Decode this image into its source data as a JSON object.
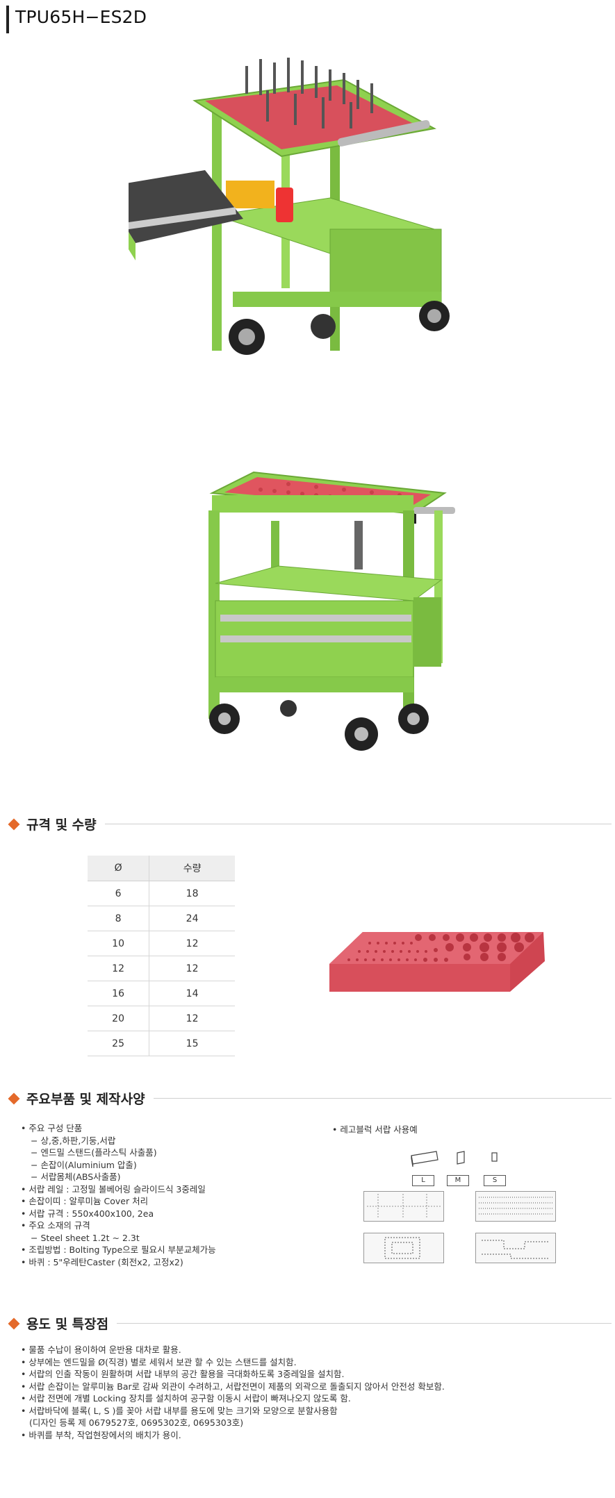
{
  "title": "TPU65H−ES2D",
  "sections": {
    "spec": "규격 및 수량",
    "parts": "주요부품 및 제작사양",
    "uses": "용도 및 특장점"
  },
  "spec_table": {
    "headers": [
      "Ø",
      "수량"
    ],
    "rows": [
      [
        "6",
        "18"
      ],
      [
        "8",
        "24"
      ],
      [
        "10",
        "12"
      ],
      [
        "12",
        "12"
      ],
      [
        "16",
        "14"
      ],
      [
        "20",
        "12"
      ],
      [
        "25",
        "15"
      ]
    ]
  },
  "parts_list": [
    {
      "t": "주요 구성 단품",
      "sub": [
        "− 상,중,하판,기둥,서랍",
        "− 엔드밀 스탠드(플라스틱 사출품)",
        "− 손잡이(Aluminium 압출)",
        "− 서랍몸체(ABS사출품)"
      ]
    },
    {
      "t": "서랍 레일 : 고정밀 볼베어링 슬라이드식 3중레일",
      "sub": []
    },
    {
      "t": "손잡이띠 : 알루미늄 Cover 처리",
      "sub": []
    },
    {
      "t": "서랍 규격 : 550x400x100, 2ea",
      "sub": []
    },
    {
      "t": "주요 소재의 규격",
      "sub": [
        "− Steel sheet 1.2t ∼ 2.3t"
      ]
    },
    {
      "t": "조립방법 : Bolting Type으로 필요시 부분교체가능",
      "sub": []
    },
    {
      "t": "바퀴 : 5\"우레탄Caster (회전x2, 고정x2)",
      "sub": []
    }
  ],
  "lego": {
    "title": "레고블럭 서랍 사용예",
    "tags": [
      "L",
      "M",
      "S"
    ]
  },
  "uses_list": [
    {
      "t": "물품 수납이 용이하여 운반용 대차로 활용.",
      "sub": []
    },
    {
      "t": "상부에는 엔드밀을 Ø(직경) 별로 세워서 보관 할 수 있는 스탠드를 설치함.",
      "sub": []
    },
    {
      "t": "서랍의 인출 작동이 원활하며 서랍 내부의 공간 활용을 극대화하도록  3중레일을 설치함.",
      "sub": []
    },
    {
      "t": "서랍 손잡이는 알루미늄 Bar로 감싸 외관이 수려하고, 서랍전면이 제품의 외곽으로 돌출되지 않아서 안전성 확보함.",
      "sub": []
    },
    {
      "t": "서랍 전면에 개별 Locking 장치를 설치하여 공구함 이동시 서랍이 빠져나오지 않도록 함.",
      "sub": []
    },
    {
      "t": "서랍바닥에 블록( L, S )를 꽂아 서랍 내부를 용도에 맞는 크기와 모양으로 분할사용함",
      "sub": [
        "(디자인 등록 제 0679527호, 0695302호, 0695303호)"
      ]
    },
    {
      "t": "바퀴를 부착, 작업현장에서의 배치가 용이.",
      "sub": []
    }
  ],
  "colors": {
    "cart_green": "#8fd14f",
    "tray_red": "#e0555f",
    "accent": "#e4692a"
  }
}
